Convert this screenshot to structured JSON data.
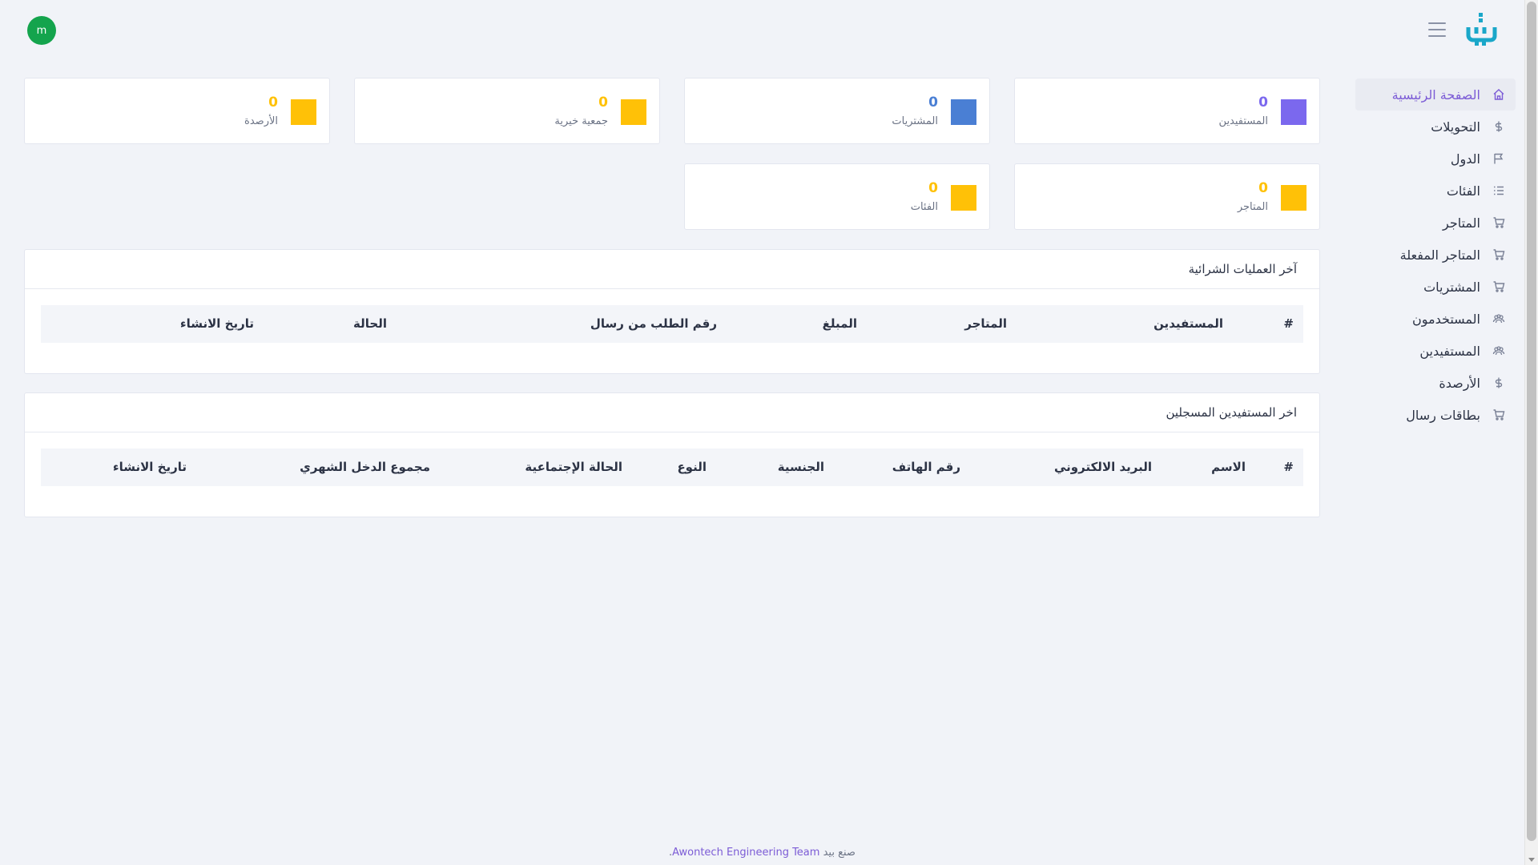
{
  "header": {
    "avatar_letter": "m",
    "menu_icon": "hamburger-icon",
    "logo_icon": "brand-logo-icon"
  },
  "colors": {
    "accent": "#7c5cd6",
    "purple": "#7b68ee",
    "blue": "#4a7fd4",
    "yellow": "#ffc107",
    "avatar_green": "#14a44d"
  },
  "sidebar": {
    "items": [
      {
        "label": "الصفحة الرئيسية",
        "icon": "home-icon",
        "active": true
      },
      {
        "label": "التحويلات",
        "icon": "dollar-icon"
      },
      {
        "label": "الدول",
        "icon": "flag-icon"
      },
      {
        "label": "الفئات",
        "icon": "list-icon"
      },
      {
        "label": "المتاجر",
        "icon": "cart-icon"
      },
      {
        "label": "المتاجر المفعلة",
        "icon": "cart-icon"
      },
      {
        "label": "المشتريات",
        "icon": "cart-icon"
      },
      {
        "label": "المستخدمون",
        "icon": "users-icon"
      },
      {
        "label": "المستفيدين",
        "icon": "users-icon"
      },
      {
        "label": "الأرصدة",
        "icon": "dollar-icon"
      },
      {
        "label": "بطاقات رسال",
        "icon": "cart-icon"
      }
    ]
  },
  "stats": [
    {
      "value": "0",
      "label": "المستفيدين",
      "color": "#7b68ee"
    },
    {
      "value": "0",
      "label": "المشتريات",
      "color": "#4a7fd4"
    },
    {
      "value": "0",
      "label": "جمعية خيرية",
      "color": "#ffc107"
    },
    {
      "value": "0",
      "label": "الأرصدة",
      "color": "#ffc107"
    },
    {
      "value": "0",
      "label": "المتاجر",
      "color": "#ffc107"
    },
    {
      "value": "0",
      "label": "الفئات",
      "color": "#ffc107"
    }
  ],
  "purchases_panel": {
    "title": "آخر العمليات الشرائية",
    "columns": [
      "#",
      "المستفيدين",
      "المتاجر",
      "المبلغ",
      "رقم الطلب من رسال",
      "الحالة",
      "تاريخ الانشاء"
    ]
  },
  "beneficiaries_panel": {
    "title": "اخر المستفيدين المسجلين",
    "columns": [
      "#",
      "الاسم",
      "البريد الالكتروني",
      "رقم الهاتف",
      "الجنسية",
      "النوع",
      "الحالة الإجتماعية",
      "مجموع الدخل الشهري",
      "تاريخ الانشاء"
    ]
  },
  "footer": {
    "prefix": "صنع بيد",
    "link": "Awontech Engineering Team",
    "suffix": "."
  }
}
